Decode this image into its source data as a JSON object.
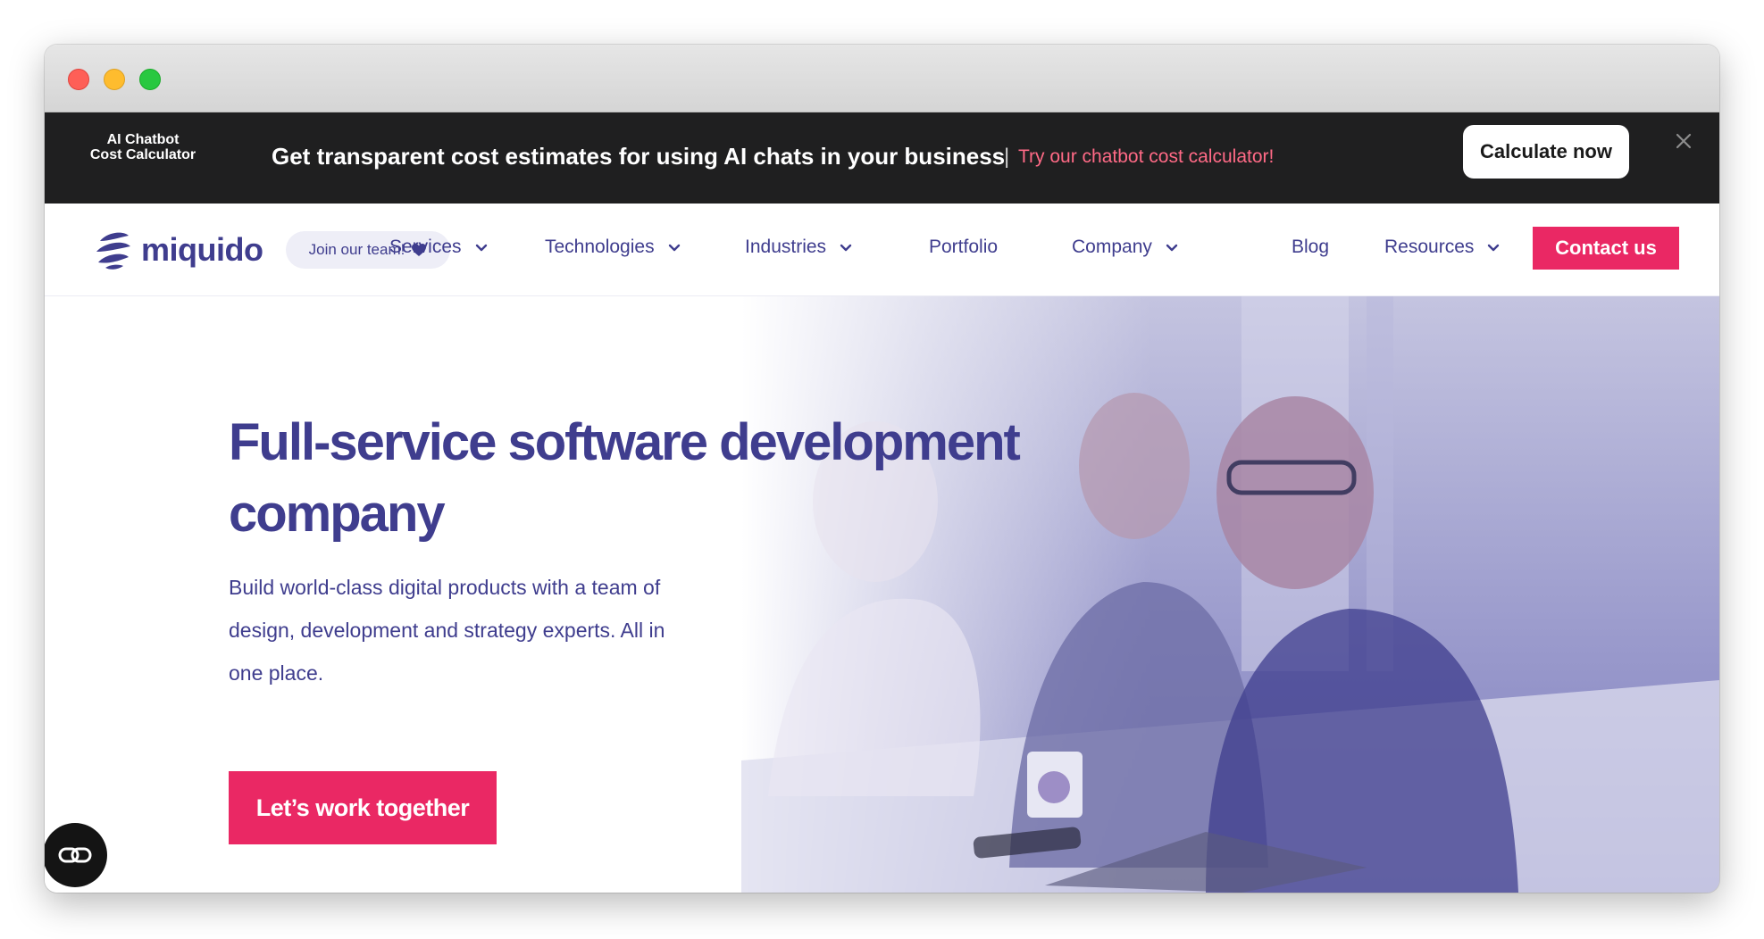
{
  "colors": {
    "brand_indigo": "#3f3d8e",
    "accent_pink": "#ea2864",
    "banner_bg": "#1f1f20",
    "banner_link": "#ff6a86"
  },
  "window": {
    "controls": [
      "close",
      "minimize",
      "maximize"
    ]
  },
  "promo": {
    "logo_line1": "AI Chatbot",
    "logo_line2": "Cost Calculator",
    "headline": "Get transparent cost estimates for using AI chats in your business",
    "separator": "|",
    "link": "Try our chatbot cost calculator!",
    "cta": "Calculate now",
    "close_icon": "close-icon"
  },
  "nav": {
    "brand": "miquido",
    "join": "Join our team!",
    "join_icon": "heart-icon",
    "items": [
      {
        "label": "Services",
        "dropdown": true
      },
      {
        "label": "Technologies",
        "dropdown": true
      },
      {
        "label": "Industries",
        "dropdown": true
      },
      {
        "label": "Portfolio",
        "dropdown": false
      },
      {
        "label": "Company",
        "dropdown": true
      },
      {
        "label": "Blog",
        "dropdown": false
      },
      {
        "label": "Resources",
        "dropdown": true
      }
    ],
    "contact": "Contact us"
  },
  "hero": {
    "title_line1": "Full-service software development",
    "title_line2": "company",
    "subtitle_line1": "Build world-class digital products with a team of",
    "subtitle_line2": "design, development and strategy experts. All in",
    "subtitle_line3": "one place.",
    "cta": "Let’s work together",
    "fab_icon": "link-icon"
  }
}
